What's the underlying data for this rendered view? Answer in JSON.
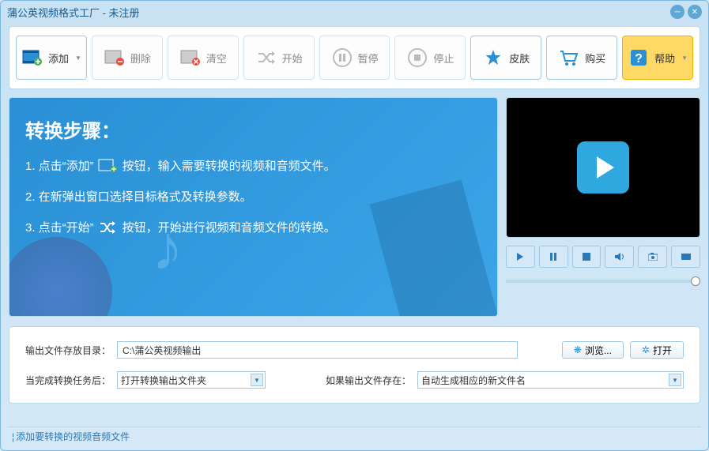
{
  "window": {
    "title": "蒲公英视频格式工厂 - 未注册"
  },
  "toolbar": {
    "add": "添加",
    "delete": "删除",
    "clear": "清空",
    "start": "开始",
    "pause": "暂停",
    "stop": "停止",
    "skin": "皮肤",
    "buy": "购买",
    "help": "帮助"
  },
  "guide": {
    "heading": "转换步骤：",
    "step1a": "1. 点击“添加”",
    "step1b": "按钮，输入需要转换的视频和音频文件。",
    "step2": "2. 在新弹出窗口选择目标格式及转换参数。",
    "step3a": "3. 点击“开始”",
    "step3b": "按钮，开始进行视频和音频文件的转换。"
  },
  "output": {
    "dir_label": "输出文件存放目录：",
    "dir_value": "C:\\蒲公英视频输出",
    "browse": "浏览...",
    "open": "打开",
    "after_label": "当完成转换任务后：",
    "after_value": "打开转换输出文件夹",
    "exists_label": "如果输出文件存在：",
    "exists_value": "自动生成相应的新文件名"
  },
  "status": "添加要转换的视频音频文件"
}
